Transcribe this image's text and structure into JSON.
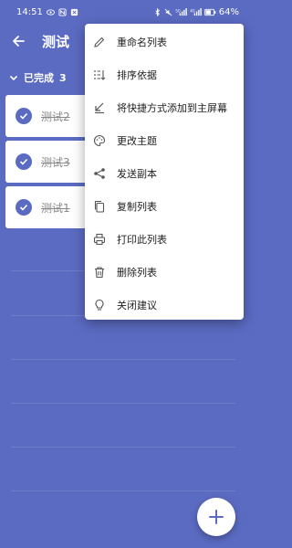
{
  "status_bar": {
    "time": "14:51",
    "battery": "64%"
  },
  "app_bar": {
    "title": "测试"
  },
  "completed_section": {
    "label": "已完成",
    "count": "3"
  },
  "tasks": [
    {
      "text": "测试2"
    },
    {
      "text": "测试3"
    },
    {
      "text": "测试1"
    }
  ],
  "menu": {
    "items": [
      {
        "label": "重命名列表",
        "icon": "pencil-icon"
      },
      {
        "label": "排序依据",
        "icon": "sort-icon"
      },
      {
        "label": "将快捷方式添加到主屏幕",
        "icon": "shortcut-arrow-icon"
      },
      {
        "label": "更改主题",
        "icon": "palette-icon"
      },
      {
        "label": "发送副本",
        "icon": "share-icon"
      },
      {
        "label": "复制列表",
        "icon": "copy-icon"
      },
      {
        "label": "打印此列表",
        "icon": "printer-icon"
      },
      {
        "label": "删除列表",
        "icon": "trash-icon"
      },
      {
        "label": "关闭建议",
        "icon": "lightbulb-icon"
      }
    ]
  },
  "colors": {
    "background": "#5b6bc2",
    "accent": "#5b6bc2",
    "menu_bg": "#ffffff"
  }
}
